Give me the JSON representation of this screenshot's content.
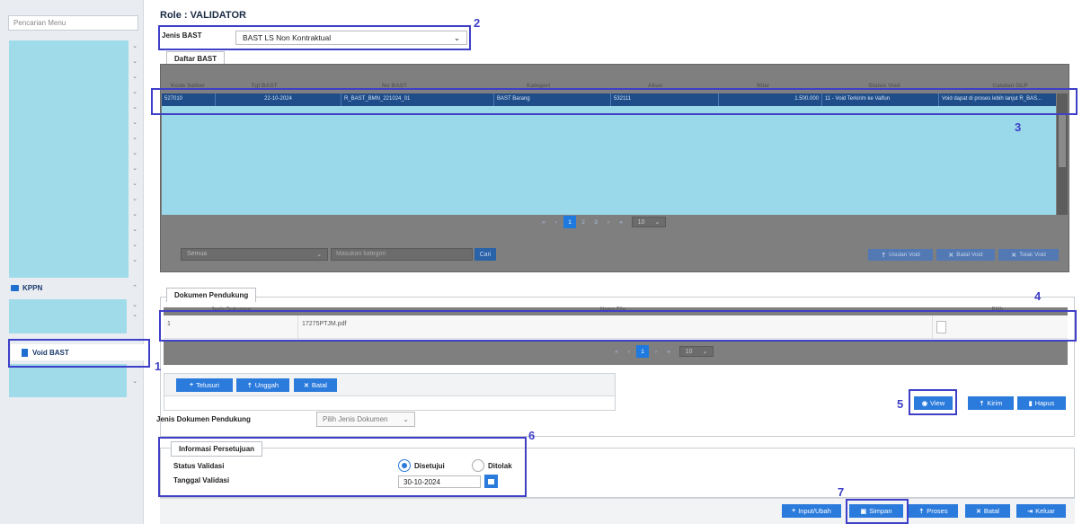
{
  "sidebar": {
    "search_placeholder": "Pencarian Menu",
    "kppn_label": "KPPN",
    "void_label": "Void BAST",
    "chevron": "⌄",
    "chevron_up": "⌃"
  },
  "header": {
    "role_title": "Role : VALIDATOR",
    "jenis_label": "Jenis BAST",
    "jenis_value": "BAST LS Non Kontraktual"
  },
  "bast": {
    "tab_label": "Daftar BAST",
    "columns": [
      "Kode Satker",
      "Tgl BAST",
      "No BAST",
      "Kategori",
      "Akun",
      "Nilai",
      "Status Void",
      "Catatan GLP"
    ],
    "rows": [
      [
        "527010",
        "22-10-2024",
        "R_BAST_BMN_221024_01",
        "BAST Barang",
        "532111",
        "1.500.000",
        "11 - Void Terkirim ke Valfun",
        "Void dapat di proses lebih lanjut R_BAS..."
      ]
    ],
    "pager": {
      "first": "«",
      "prev": "‹",
      "pages": [
        "1",
        "2",
        "3"
      ],
      "next": "›",
      "last": "»",
      "size": "10"
    },
    "filter": {
      "select_value": "Semua",
      "input_placeholder": "Masukan kategori",
      "cari_label": "Cari"
    },
    "actions": {
      "usulan": "Usulan Void",
      "batal": "Batal Void",
      "tolak": "Tolak Void"
    }
  },
  "dokumen": {
    "tab_label": "Dokumen Pendukung",
    "columns": [
      "Jenis Dokumen",
      "Nama File",
      "Pilih"
    ],
    "rows": [
      [
        "1",
        "17275PTJM.pdf",
        ""
      ]
    ],
    "pager": {
      "first": "«",
      "prev": "‹",
      "page": "1",
      "next": "›",
      "last": "»",
      "size": "10"
    },
    "upload": {
      "telusuri": "Telusuri",
      "unggah": "Unggah",
      "batal": "Batal"
    },
    "file_actions": {
      "view": "View",
      "kirim": "Kirim",
      "hapus": "Hapus"
    },
    "jenis_label": "Jenis Dokumen Pendukung",
    "jenis_placeholder": "Pilih Jenis Dokumen"
  },
  "persetujuan": {
    "tab_label": "Informasi Persetujuan",
    "status_label": "Status Validasi",
    "disetujui": "Disetujui",
    "ditolak": "Ditolak",
    "selected": "Disetujui",
    "tanggal_label": "Tanggal Validasi",
    "tanggal_value": "30-10-2024"
  },
  "footer": {
    "input": "Input/Ubah",
    "simpan": "Simpan",
    "proses": "Proses",
    "batal": "Batal",
    "keluar": "Keluar"
  },
  "annotations": [
    "1",
    "2",
    "3",
    "4",
    "5",
    "6",
    "7"
  ],
  "colors": {
    "accent": "#2b7bdc",
    "annotation": "#3f3fc8",
    "sidebar_block": "#9fdbe9",
    "selected_row": "#1e4d8a"
  }
}
